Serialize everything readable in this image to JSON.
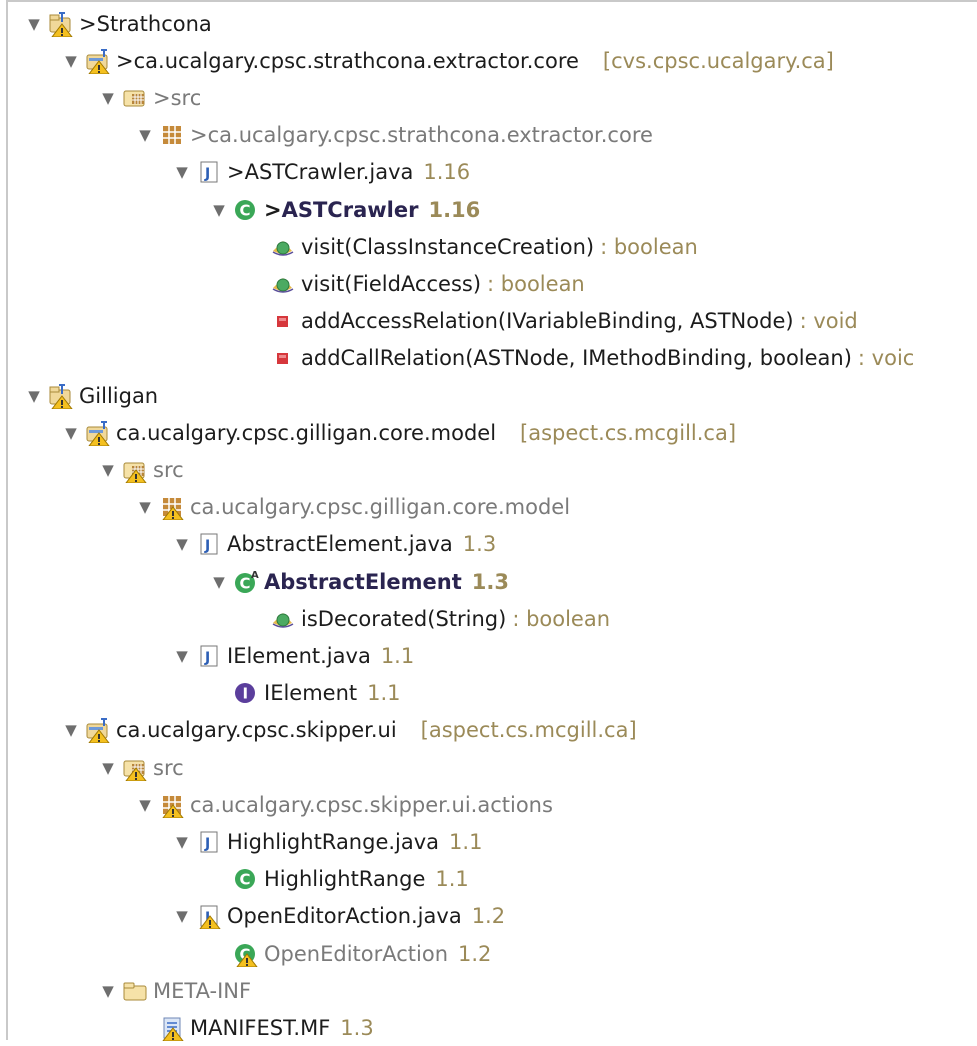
{
  "tree": {
    "rows": [
      {
        "depth": 0,
        "tw": "▼",
        "icon": "project",
        "prefix": ">",
        "label": "Strathcona",
        "style": "",
        "dec": "",
        "decClass": ""
      },
      {
        "depth": 1,
        "tw": "▼",
        "icon": "plugin-project",
        "prefix": ">",
        "label": "ca.ucalgary.cpsc.strathcona.extractor.core",
        "style": "",
        "dec": "[cvs.cpsc.ucalgary.ca]",
        "decClass": "repo"
      },
      {
        "depth": 2,
        "tw": "▼",
        "icon": "src-folder",
        "prefix": ">",
        "label": "src",
        "style": "gray",
        "dec": "",
        "decClass": ""
      },
      {
        "depth": 3,
        "tw": "▼",
        "icon": "package",
        "prefix": ">",
        "label": "ca.ucalgary.cpsc.strathcona.extractor.core",
        "style": "gray",
        "dec": "",
        "decClass": ""
      },
      {
        "depth": 4,
        "tw": "▼",
        "icon": "java-file",
        "prefix": ">",
        "label": "ASTCrawler.java",
        "style": "",
        "dec": "1.16",
        "decClass": ""
      },
      {
        "depth": 5,
        "tw": "▼",
        "icon": "class",
        "prefix": ">",
        "label": "ASTCrawler",
        "style": "bold",
        "dec": "1.16",
        "decClass": "bold"
      },
      {
        "depth": 6,
        "tw": "",
        "icon": "method-protected",
        "prefix": "",
        "label": "visit(ClassInstanceCreation)",
        "style": "",
        "dec": ": boolean",
        "decClass": "sig"
      },
      {
        "depth": 6,
        "tw": "",
        "icon": "method-protected",
        "prefix": "",
        "label": "visit(FieldAccess)",
        "style": "",
        "dec": ": boolean",
        "decClass": "sig"
      },
      {
        "depth": 6,
        "tw": "",
        "icon": "method-private",
        "prefix": "",
        "label": "addAccessRelation(IVariableBinding, ASTNode)",
        "style": "",
        "dec": ": void",
        "decClass": "sig"
      },
      {
        "depth": 6,
        "tw": "",
        "icon": "method-private",
        "prefix": "",
        "label": "addCallRelation(ASTNode, IMethodBinding, boolean)",
        "style": "",
        "dec": ": voic",
        "decClass": "sig"
      },
      {
        "depth": 0,
        "tw": "▼",
        "icon": "project",
        "prefix": "",
        "label": "Gilligan",
        "style": "",
        "dec": "",
        "decClass": ""
      },
      {
        "depth": 1,
        "tw": "▼",
        "icon": "plugin-project",
        "prefix": "",
        "label": "ca.ucalgary.cpsc.gilligan.core.model",
        "style": "",
        "dec": "[aspect.cs.mcgill.ca]",
        "decClass": "repo"
      },
      {
        "depth": 2,
        "tw": "▼",
        "icon": "src-folder-warn",
        "prefix": "",
        "label": "src",
        "style": "gray",
        "dec": "",
        "decClass": ""
      },
      {
        "depth": 3,
        "tw": "▼",
        "icon": "package-warn",
        "prefix": "",
        "label": "ca.ucalgary.cpsc.gilligan.core.model",
        "style": "gray",
        "dec": "",
        "decClass": ""
      },
      {
        "depth": 4,
        "tw": "▼",
        "icon": "java-file",
        "prefix": "",
        "label": "AbstractElement.java",
        "style": "",
        "dec": "1.3",
        "decClass": ""
      },
      {
        "depth": 5,
        "tw": "▼",
        "icon": "abstract-class",
        "prefix": "",
        "label": "AbstractElement",
        "style": "bold",
        "dec": "1.3",
        "decClass": "bold"
      },
      {
        "depth": 6,
        "tw": "",
        "icon": "method-protected",
        "prefix": "",
        "label": "isDecorated(String)",
        "style": "",
        "dec": ": boolean",
        "decClass": "sig"
      },
      {
        "depth": 4,
        "tw": "▼",
        "icon": "java-file",
        "prefix": "",
        "label": "IElement.java",
        "style": "",
        "dec": "1.1",
        "decClass": ""
      },
      {
        "depth": 5,
        "tw": "",
        "icon": "interface",
        "prefix": "",
        "label": "IElement",
        "style": "",
        "dec": "1.1",
        "decClass": ""
      },
      {
        "depth": 1,
        "tw": "▼",
        "icon": "plugin-project",
        "prefix": "",
        "label": "ca.ucalgary.cpsc.skipper.ui",
        "style": "",
        "dec": "[aspect.cs.mcgill.ca]",
        "decClass": "repo"
      },
      {
        "depth": 2,
        "tw": "▼",
        "icon": "src-folder-warn",
        "prefix": "",
        "label": "src",
        "style": "gray",
        "dec": "",
        "decClass": ""
      },
      {
        "depth": 3,
        "tw": "▼",
        "icon": "package-warn",
        "prefix": "",
        "label": "ca.ucalgary.cpsc.skipper.ui.actions",
        "style": "gray",
        "dec": "",
        "decClass": ""
      },
      {
        "depth": 4,
        "tw": "▼",
        "icon": "java-file",
        "prefix": "",
        "label": "HighlightRange.java",
        "style": "",
        "dec": "1.1",
        "decClass": ""
      },
      {
        "depth": 5,
        "tw": "",
        "icon": "class",
        "prefix": "",
        "label": "HighlightRange",
        "style": "",
        "dec": "1.1",
        "decClass": ""
      },
      {
        "depth": 4,
        "tw": "▼",
        "icon": "java-file-warn",
        "prefix": "",
        "label": "OpenEditorAction.java",
        "style": "",
        "dec": "1.2",
        "decClass": ""
      },
      {
        "depth": 5,
        "tw": "",
        "icon": "class-warn",
        "prefix": "",
        "label": "OpenEditorAction",
        "style": "gray",
        "dec": "1.2",
        "decClass": ""
      },
      {
        "depth": 2,
        "tw": "▼",
        "icon": "folder",
        "prefix": "",
        "label": "META-INF",
        "style": "gray",
        "dec": "",
        "decClass": ""
      },
      {
        "depth": 3,
        "tw": "",
        "icon": "manifest-file",
        "prefix": "",
        "label": "MANIFEST.MF",
        "style": "",
        "dec": "1.3",
        "decClass": ""
      }
    ]
  },
  "colors": {
    "decoration": "#9b8a58",
    "class-icon": "#3aa757",
    "private-method": "#d6373c",
    "interface-icon": "#5b3e9c",
    "package-brown": "#b8863a"
  }
}
